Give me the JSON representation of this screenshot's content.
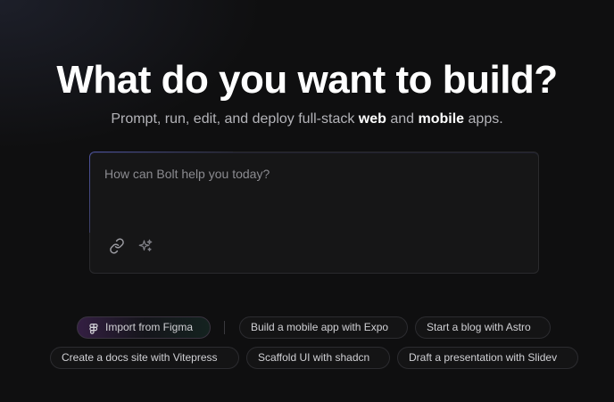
{
  "hero": {
    "title": "What do you want to build?",
    "subtitle_prefix": "Prompt, run, edit, and deploy full-stack ",
    "subtitle_web": "web",
    "subtitle_and": " and ",
    "subtitle_mobile": "mobile",
    "subtitle_suffix": " apps."
  },
  "prompt": {
    "placeholder": "How can Bolt help you today?",
    "value": "",
    "tools": [
      {
        "name": "link-icon"
      },
      {
        "name": "sparkles-icon"
      }
    ]
  },
  "suggestions": {
    "figma": {
      "label": "Import from Figma",
      "icon": "figma-icon"
    },
    "items": [
      "Build a mobile app with Expo",
      "Start a blog with Astro",
      "Create a docs site with Vitepress",
      "Scaffold UI with shadcn",
      "Draft a presentation with Slidev"
    ]
  },
  "colors": {
    "background": "#0f0f10",
    "accent": "#6e78ff",
    "text_muted": "#b3b3b8"
  }
}
